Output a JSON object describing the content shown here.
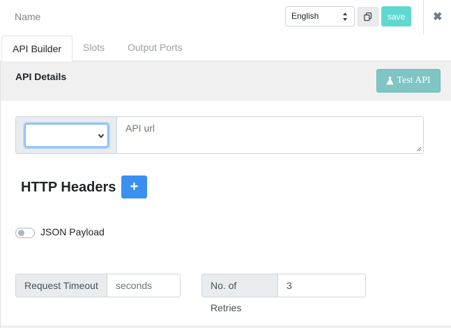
{
  "topbar": {
    "name_placeholder": "Name",
    "language": "English",
    "save_label": "save",
    "close_glyph": "✖"
  },
  "tabs": [
    {
      "label": "API Builder",
      "active": true
    },
    {
      "label": "Slots",
      "active": false
    },
    {
      "label": "Output Ports",
      "active": false
    }
  ],
  "panel": {
    "title": "API Details",
    "test_label": "Test API",
    "url_placeholder": "API url",
    "method_value": "",
    "headers_title": "HTTP Headers",
    "add_header_glyph": "+",
    "json_payload_label": "JSON Payload",
    "json_payload_enabled": false,
    "timeout_label": "Request Timeout",
    "timeout_placeholder": "seconds",
    "retries_label": "No. of Retries",
    "retries_value": "3"
  },
  "colors": {
    "save_button": "#5fd9d0",
    "test_button": "#7fc5c4",
    "add_button": "#3b8ff0",
    "focus_ring": "#80bdff"
  },
  "icons": {
    "copy": "copy-icon",
    "close": "close-icon",
    "flask": "flask-icon",
    "plus": "plus-icon"
  }
}
